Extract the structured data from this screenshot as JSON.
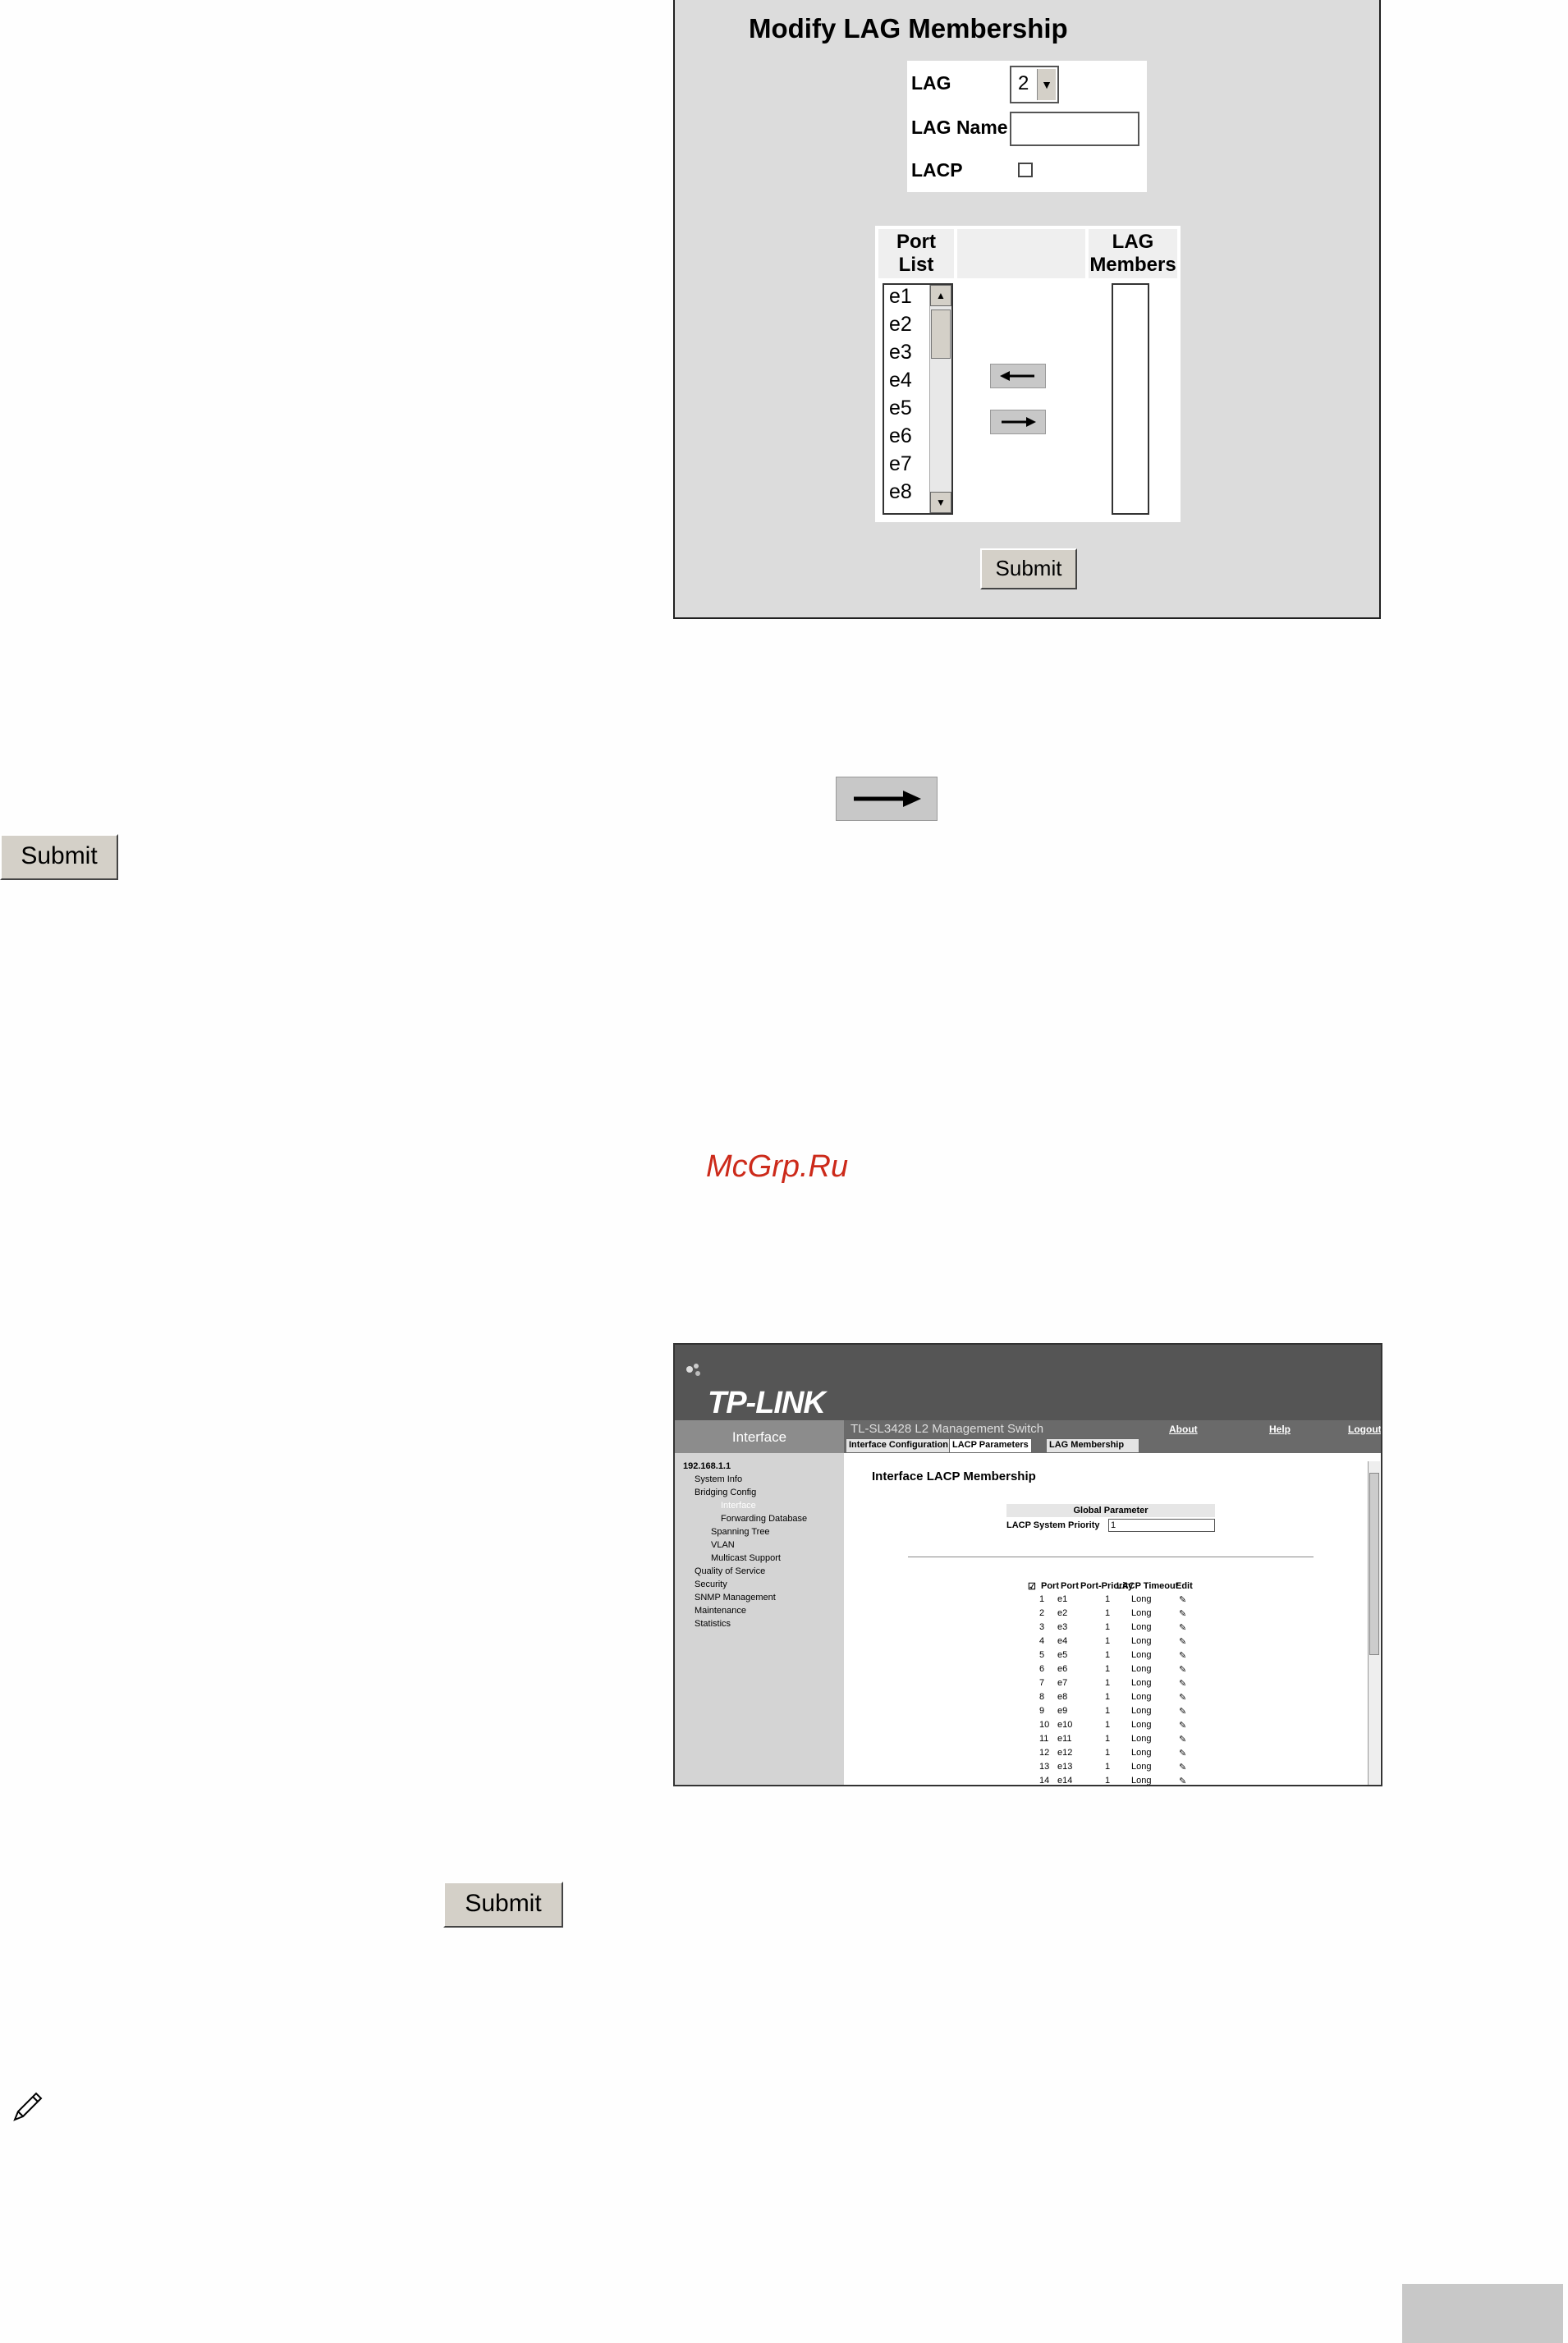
{
  "lag_form": {
    "title": "Modify LAG Membership",
    "lag_label": "LAG",
    "lag_value": "2",
    "lag_name_label": "LAG Name",
    "lag_name_value": "",
    "lacp_label": "LACP",
    "lacp_checked": false,
    "port_list_header": [
      "Port",
      "List"
    ],
    "lag_members_header": [
      "LAG",
      "Members"
    ],
    "ports": [
      "e1",
      "e2",
      "e3",
      "e4",
      "e5",
      "e6",
      "e7",
      "e8"
    ],
    "lag_members": [],
    "submit_label": "Submit"
  },
  "standalone": {
    "submit_label_1": "Submit",
    "submit_label_2": "Submit",
    "watermark": "McGrp.Ru"
  },
  "lacp_window": {
    "logo": "TP-LINK",
    "sidebar_header": "Interface",
    "device_title": "TL-SL3428 L2 Management Switch",
    "top_links": [
      "About",
      "Help",
      "Logout"
    ],
    "tabs": [
      "Interface Configuration",
      "LACP Parameters",
      "LAG Membership"
    ],
    "active_tab": "LACP Parameters",
    "tree": [
      {
        "label": "192.168.1.1",
        "level": 0
      },
      {
        "label": "System Info",
        "level": 1
      },
      {
        "label": "Bridging Config",
        "level": 1
      },
      {
        "label": "Interface",
        "level": 2
      },
      {
        "label": "Forwarding Database",
        "level": 2
      },
      {
        "label": "Spanning Tree",
        "level": 2
      },
      {
        "label": "VLAN",
        "level": 2
      },
      {
        "label": "Multicast Support",
        "level": 2
      },
      {
        "label": "Quality of Service",
        "level": 1
      },
      {
        "label": "Security",
        "level": 1
      },
      {
        "label": "SNMP Management",
        "level": 1
      },
      {
        "label": "Maintenance",
        "level": 1
      },
      {
        "label": "Statistics",
        "level": 1
      }
    ],
    "page_title": "Interface LACP Membership",
    "global_param_header": "Global Parameter",
    "system_priority_label": "LACP System Priority",
    "system_priority_value": "1",
    "columns": [
      "Port",
      "Port",
      "Port-Priority",
      "LACP Timeout",
      "Edit"
    ],
    "rows": [
      [
        "1",
        "e1",
        "1",
        "Long"
      ],
      [
        "2",
        "e2",
        "1",
        "Long"
      ],
      [
        "3",
        "e3",
        "1",
        "Long"
      ],
      [
        "4",
        "e4",
        "1",
        "Long"
      ],
      [
        "5",
        "e5",
        "1",
        "Long"
      ],
      [
        "6",
        "e6",
        "1",
        "Long"
      ],
      [
        "7",
        "e7",
        "1",
        "Long"
      ],
      [
        "8",
        "e8",
        "1",
        "Long"
      ],
      [
        "9",
        "e9",
        "1",
        "Long"
      ],
      [
        "10",
        "e10",
        "1",
        "Long"
      ],
      [
        "11",
        "e11",
        "1",
        "Long"
      ],
      [
        "12",
        "e12",
        "1",
        "Long"
      ],
      [
        "13",
        "e13",
        "1",
        "Long"
      ],
      [
        "14",
        "e14",
        "1",
        "Long"
      ]
    ]
  }
}
